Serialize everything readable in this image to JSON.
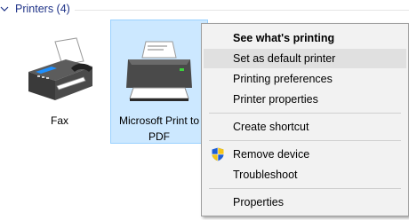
{
  "group": {
    "title": "Printers (4)"
  },
  "devices": [
    {
      "label": "Fax",
      "icon": "fax-icon"
    },
    {
      "label": "Microsoft Print to PDF",
      "icon": "printer-icon",
      "selected": true
    }
  ],
  "context_menu": {
    "items": [
      {
        "label": "See what's printing",
        "bold": true
      },
      {
        "label": "Set as default printer",
        "hover": true
      },
      {
        "label": "Printing preferences"
      },
      {
        "label": "Printer properties"
      },
      {
        "label": "Create shortcut"
      },
      {
        "label": "Remove device",
        "icon": "uac-shield-icon"
      },
      {
        "label": "Troubleshoot"
      },
      {
        "label": "Properties"
      }
    ]
  },
  "colors": {
    "header_text": "#1e3287",
    "selection_fill": "#cce8ff",
    "selection_border": "#99d1ff",
    "menu_background": "#f2f2f2",
    "menu_hover": "#e0e0e0"
  }
}
